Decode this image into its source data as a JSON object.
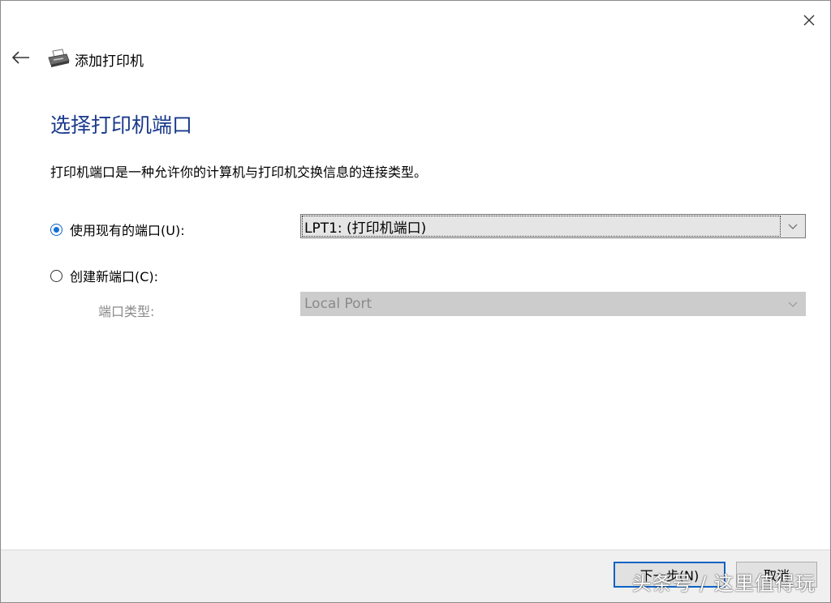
{
  "window": {
    "title": "添加打印机",
    "close_icon": "close-icon",
    "back_icon": "back-arrow-icon",
    "app_icon": "printer-icon"
  },
  "page": {
    "heading": "选择打印机端口",
    "description": "打印机端口是一种允许你的计算机与打印机交换信息的连接类型。"
  },
  "options": {
    "use_existing": {
      "label": "使用现有的端口(U):",
      "selected": true,
      "value": "LPT1: (打印机端口)"
    },
    "create_new": {
      "label": "创建新端口(C):",
      "selected": false,
      "type_label": "端口类型:",
      "type_value": "Local Port"
    }
  },
  "footer": {
    "next_label": "下一步(N)",
    "cancel_label": "取消"
  },
  "watermark": "头条号 / 这里值得玩",
  "colors": {
    "heading": "#1a3a8c",
    "accent": "#0b63c5"
  }
}
